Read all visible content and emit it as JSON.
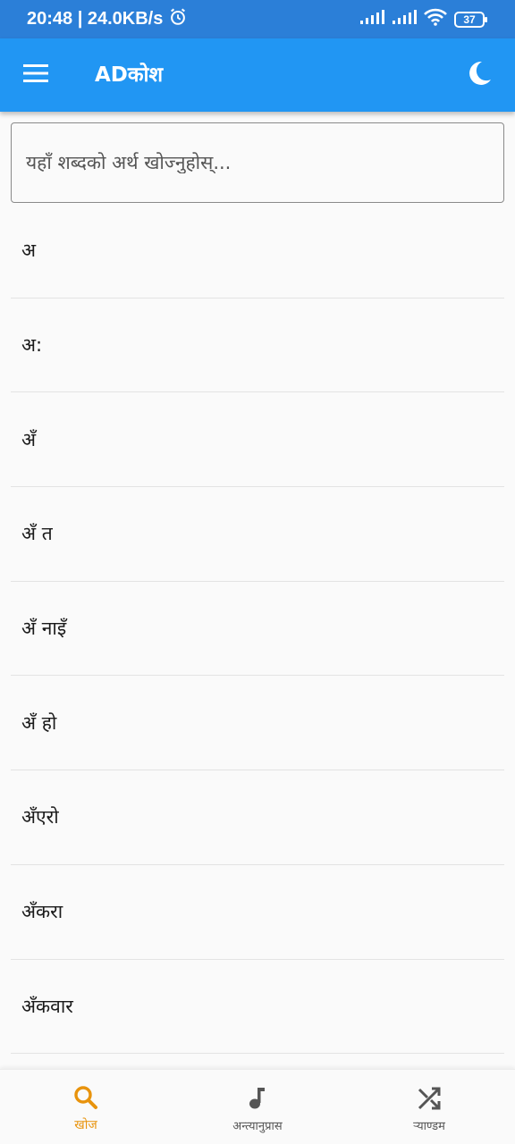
{
  "status_bar": {
    "time_speed": "20:48 | 24.0KB/s",
    "battery": "37"
  },
  "app_bar": {
    "title": "ADकोश",
    "menu_icon": "hamburger-menu-icon",
    "theme_icon": "moon-icon"
  },
  "search": {
    "placeholder": "यहाँ शब्दको अर्थ खोज्नुहोस्..."
  },
  "words": [
    "अ",
    "अ:",
    "अँ",
    "अँ त",
    "अँ नाइँ",
    "अँ हो",
    "अँएरो",
    "अँकरा",
    "अँकवार"
  ],
  "bottom_nav": {
    "items": [
      {
        "label": "खोज",
        "icon": "search-icon",
        "active": true
      },
      {
        "label": "अन्त्यानुप्रास",
        "icon": "music-note-icon",
        "active": false
      },
      {
        "label": "र्‍याण्डम",
        "icon": "shuffle-icon",
        "active": false
      }
    ]
  },
  "colors": {
    "app_bar": "#2196f3",
    "status_bar": "#2b7fd8",
    "active_nav": "#e8930c",
    "inactive_nav": "#555555"
  }
}
